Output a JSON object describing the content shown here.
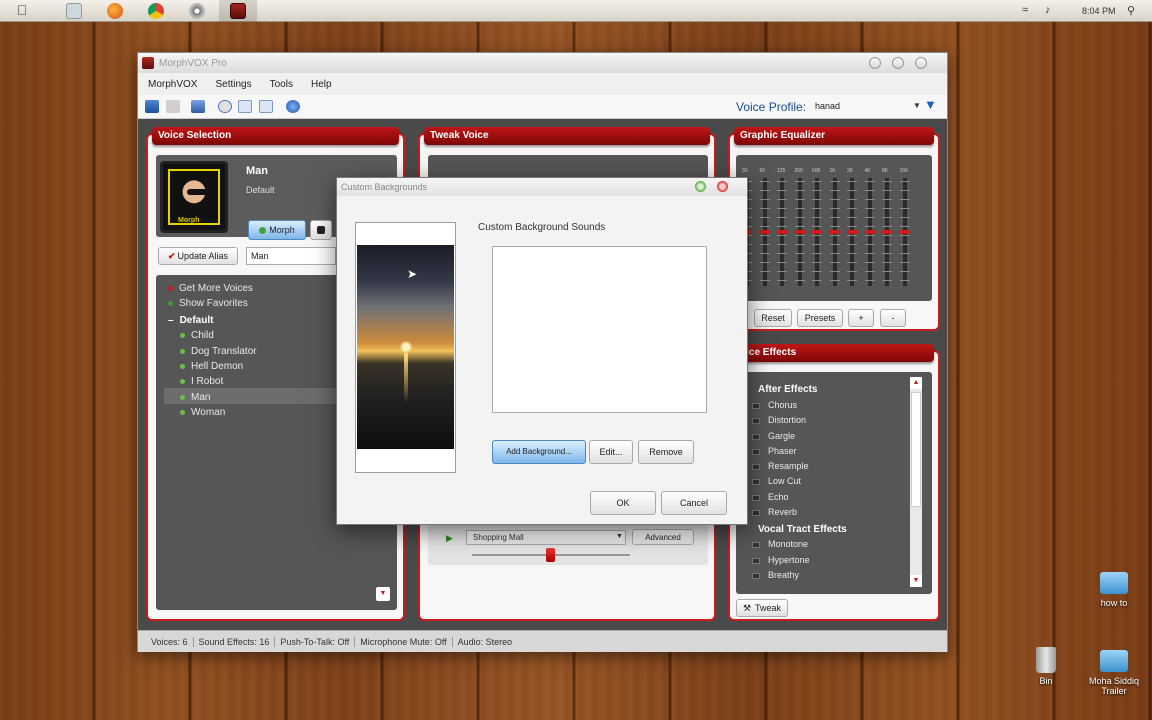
{
  "system_bar": {
    "time": "8:04 PM"
  },
  "window": {
    "title": "MorphVOX Pro",
    "menu": [
      "MorphVOX",
      "Settings",
      "Tools",
      "Help"
    ],
    "voice_profile_label": "Voice Profile:",
    "voice_profile_value": "hanad"
  },
  "voice_selection": {
    "title": "Voice Selection",
    "current_voice": "Man",
    "current_group": "Default",
    "morph_label": "Morph",
    "update_alias_label": "Update Alias",
    "alias_value": "Man",
    "get_more_voices": "Get More Voices",
    "show_favorites": "Show Favorites",
    "group_name": "Default",
    "voices": [
      "Child",
      "Dog Translator",
      "Hell Demon",
      "I Robot",
      "Man",
      "Woman"
    ]
  },
  "tweak_voice": {
    "title": "Tweak Voice",
    "background_value": "Shopping Mall",
    "advanced_label": "Advanced"
  },
  "graphic_equalizer": {
    "title": "Graphic Equalizer",
    "bands": [
      "30",
      "60",
      "125",
      "250",
      "500",
      "1K",
      "2K",
      "4K",
      "8K",
      "16K"
    ],
    "reset_label": "Reset",
    "presets_label": "Presets",
    "add_label": "+",
    "remove_label": "-"
  },
  "voice_effects": {
    "title": "oice Effects",
    "after_effects_header": "After Effects",
    "after_effects": [
      "Chorus",
      "Distortion",
      "Gargle",
      "Phaser",
      "Resample",
      "Low Cut",
      "Echo",
      "Reverb"
    ],
    "vocal_tract_header": "Vocal Tract Effects",
    "vocal_tract_effects": [
      "Monotone",
      "Hypertone",
      "Breathy"
    ],
    "tweak_label": "Tweak"
  },
  "status_bar": {
    "items": [
      "Voices: 6",
      "Sound Effects: 16",
      "Push-To-Talk: Off",
      "Microphone Mute: Off",
      "Audio: Stereo"
    ]
  },
  "dialog": {
    "title": "Custom Backgrounds",
    "group_label": "Custom Background Sounds",
    "add_label": "Add Background...",
    "edit_label": "Edit...",
    "remove_label": "Remove",
    "ok_label": "OK",
    "cancel_label": "Cancel"
  },
  "desktop": {
    "folders": [
      "how to",
      "Moha Siddiq Trailer"
    ],
    "bin_label": "Bin"
  }
}
